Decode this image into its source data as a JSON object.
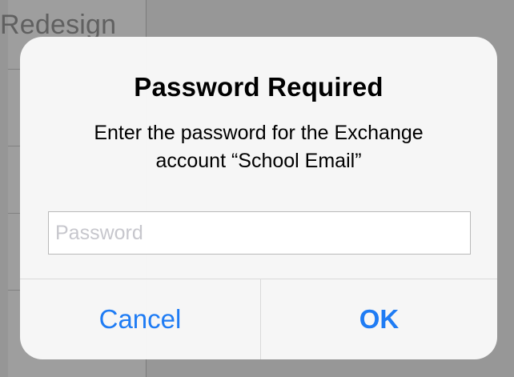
{
  "background": {
    "left_panel_title": "Redesign"
  },
  "alert": {
    "title": "Password Required",
    "message": "Enter the password for the Exchange account “School Email”",
    "password_field": {
      "value": "",
      "placeholder": "Password"
    },
    "buttons": {
      "cancel_label": "Cancel",
      "ok_label": "OK"
    }
  },
  "colors": {
    "accent": "#1F7CF4",
    "dialog_background": "#F8F8F8",
    "overlay": "#000000"
  }
}
